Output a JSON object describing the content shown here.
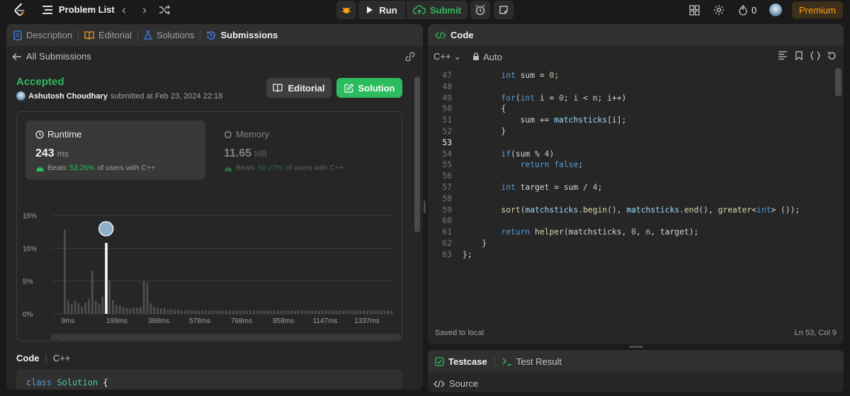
{
  "topbar": {
    "problem_list": "Problem List",
    "run": "Run",
    "submit": "Submit",
    "streak": "0",
    "premium": "Premium"
  },
  "left_tabs": [
    {
      "label": "Description",
      "icon": "description-icon"
    },
    {
      "label": "Editorial",
      "icon": "book-icon"
    },
    {
      "label": "Solutions",
      "icon": "flask-icon"
    },
    {
      "label": "Submissions",
      "icon": "history-icon"
    }
  ],
  "submission": {
    "back": "All Submissions",
    "status": "Accepted",
    "user": "Ashutosh Choudhary",
    "submitted_text": "submitted at Feb 23, 2024 22:18",
    "editorial_btn": "Editorial",
    "solution_btn": "Solution"
  },
  "runtime": {
    "title": "Runtime",
    "value": "243",
    "unit": "ms",
    "beats_label": "Beats",
    "beats_pct": "53.26%",
    "beats_suffix": "of users with C++"
  },
  "memory": {
    "title": "Memory",
    "value": "11.65",
    "unit": "MB",
    "beats_label": "Beats",
    "beats_pct": "59.27%",
    "beats_suffix": "of users with C++"
  },
  "chart_data": {
    "type": "bar",
    "y_ticks": [
      "15%",
      "10%",
      "5%",
      "0%"
    ],
    "ylim": [
      0,
      15
    ],
    "x_ticks": [
      "9ms",
      "199ms",
      "388ms",
      "578ms",
      "768ms",
      "958ms",
      "1147ms",
      "1337ms"
    ],
    "values": [
      12.8,
      2.1,
      1.5,
      2.0,
      1.6,
      1.2,
      1.7,
      2.3,
      6.6,
      2.0,
      1.6,
      2.6,
      10.8,
      5.0,
      2.1,
      1.4,
      1.2,
      1.0,
      0.9,
      0.8,
      1.0,
      0.9,
      1.0,
      5.0,
      4.7,
      1.6,
      1.1,
      0.9,
      0.8,
      0.9,
      0.6,
      0.7,
      0.6,
      0.6,
      0.5,
      0.5,
      0.6,
      0.5,
      0.5,
      0.5,
      0.5,
      0.5,
      0.5,
      0.5,
      0.5,
      0.5,
      0.5,
      0.5,
      0.5,
      0.5,
      0.5,
      0.5,
      0.5,
      0.5,
      0.5,
      0.5,
      0.5,
      0.5,
      0.5,
      0.5,
      0.5,
      0.5,
      0.5,
      0.5,
      0.5,
      0.5,
      0.5,
      0.5,
      0.5,
      0.5,
      0.5,
      0.5,
      0.5,
      0.5,
      0.5,
      0.5,
      0.5,
      0.5,
      0.5,
      0.5,
      0.5,
      0.5,
      0.5,
      0.5,
      0.5,
      0.5,
      0.5,
      0.5,
      0.5,
      0.5,
      0.5,
      0.5,
      0.5,
      0.5,
      0.5,
      0.5
    ],
    "highlight_index": 12,
    "grid": true,
    "legend": "none"
  },
  "code_section": {
    "label": "Code",
    "lang": "C++",
    "first_line": [
      "class",
      "Solution",
      "{"
    ]
  },
  "editor": {
    "tab": "Code",
    "lang": "C++",
    "mode": "Auto",
    "saved": "Saved to local",
    "position": "Ln 53, Col 9",
    "lines": [
      {
        "n": "47",
        "html": "        <span class='kw'>int</span> sum = <span class='num'>0</span>;"
      },
      {
        "n": "48",
        "html": ""
      },
      {
        "n": "49",
        "html": "        <span class='kw'>for</span>(<span class='kw'>int</span> i = <span class='num'>0</span>; i &lt; n; i++)"
      },
      {
        "n": "50",
        "html": "        {"
      },
      {
        "n": "51",
        "html": "            sum += <span class='var'>matchsticks</span>[i];"
      },
      {
        "n": "52",
        "html": "        }"
      },
      {
        "n": "53",
        "html": ""
      },
      {
        "n": "54",
        "html": "        <span class='kw'>if</span>(sum % <span class='num'>4</span>)"
      },
      {
        "n": "55",
        "html": "            <span class='kw'>return</span> <span class='kw'>false</span>;"
      },
      {
        "n": "56",
        "html": ""
      },
      {
        "n": "57",
        "html": "        <span class='kw'>int</span> target = sum / <span class='num'>4</span>;"
      },
      {
        "n": "58",
        "html": ""
      },
      {
        "n": "59",
        "html": "        <span class='fn'>sort</span>(<span class='var'>matchsticks</span>.<span class='fn'>begin</span>(), <span class='var'>matchsticks</span>.<span class='fn'>end</span>(), <span class='fn'>greater</span>&lt;<span class='kw'>int</span>&gt; ());"
      },
      {
        "n": "60",
        "html": ""
      },
      {
        "n": "61",
        "html": "        <span class='kw'>return</span> <span class='fn'>helper</span>(matchsticks, <span class='num'>0</span>, n, target);"
      },
      {
        "n": "62",
        "html": "    }"
      },
      {
        "n": "63",
        "html": "};"
      }
    ]
  },
  "bottom": {
    "testcase": "Testcase",
    "test_result": "Test Result",
    "source": "Source"
  }
}
